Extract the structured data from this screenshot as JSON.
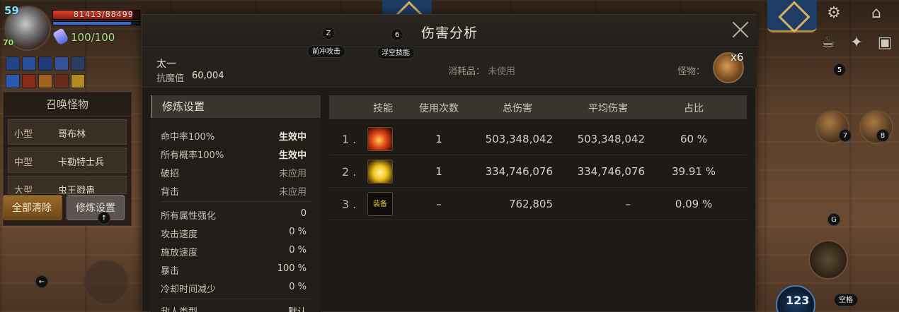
{
  "hud": {
    "level": "59",
    "sub_level": "70",
    "hp_text": "81413/88499",
    "hp_fraction": 0.92,
    "mp_fraction": 0.9,
    "fatigue": "100/100"
  },
  "summon": {
    "title": "召唤怪物",
    "rows": [
      {
        "size": "小型",
        "name": "哥布林"
      },
      {
        "size": "中型",
        "name": "卡勒特士兵"
      },
      {
        "size": "大型",
        "name": "虫王戮蛊"
      }
    ],
    "clear_label": "全部清除",
    "settings_label": "修炼设置"
  },
  "keys": {
    "z": "Z",
    "six": "6",
    "five": "5",
    "seven": "7",
    "eight": "8",
    "g": "G",
    "space": "空格",
    "dash_label": "前冲攻击",
    "float_label": "浮空技能",
    "left_arrow": "←",
    "right_arrow": "→",
    "up_arrow": "↑",
    "cooldown_text": "123"
  },
  "dialog": {
    "title": "伤害分析",
    "character": "太一",
    "resist_label": "抗魔值",
    "resist_value": "60,004",
    "consumable_label": "消耗品：",
    "consumable_value": "未使用",
    "monster_label": "怪物：",
    "monster_count": "x6"
  },
  "settings": {
    "title": "修炼设置",
    "rows": [
      {
        "label": "命中率100%",
        "value": "生效中",
        "state": "active"
      },
      {
        "label": "所有概率100%",
        "value": "生效中",
        "state": "active"
      },
      {
        "label": "破招",
        "value": "未应用",
        "state": "inactive"
      },
      {
        "label": "背击",
        "value": "未应用",
        "state": "inactive"
      },
      {
        "label": "所有属性强化",
        "value": "0",
        "state": "normal"
      },
      {
        "label": "攻击速度",
        "value": "0 %",
        "state": "normal"
      },
      {
        "label": "施放速度",
        "value": "0 %",
        "state": "normal"
      },
      {
        "label": "暴击",
        "value": "100 %",
        "state": "normal"
      },
      {
        "label": "冷却时间减少",
        "value": "0 %",
        "state": "normal"
      },
      {
        "label": "敌人类型",
        "value": "默认",
        "state": "normal"
      }
    ]
  },
  "table": {
    "headers": {
      "skill": "技能",
      "uses": "使用次数",
      "total": "总伤害",
      "avg": "平均伤害",
      "pct": "占比"
    },
    "rows": [
      {
        "rank": "1 .",
        "icon": "fire-slash-icon",
        "uses": "1",
        "total": "503,348,042",
        "avg": "503,348,042",
        "pct": "60 %"
      },
      {
        "rank": "2 .",
        "icon": "golden-burst-icon",
        "uses": "1",
        "total": "334,746,076",
        "avg": "334,746,076",
        "pct": "39.91 %"
      },
      {
        "rank": "3 .",
        "icon": "equipment-icon",
        "icon_text": "装备",
        "uses": "–",
        "total": "762,805",
        "avg": "–",
        "pct": "0.09 %"
      }
    ]
  },
  "top_right": {
    "settings_icon": "⚙",
    "home_icon": "⌂",
    "potion_icon": "☕",
    "star_icon": "✦",
    "bag_icon": "▣"
  }
}
